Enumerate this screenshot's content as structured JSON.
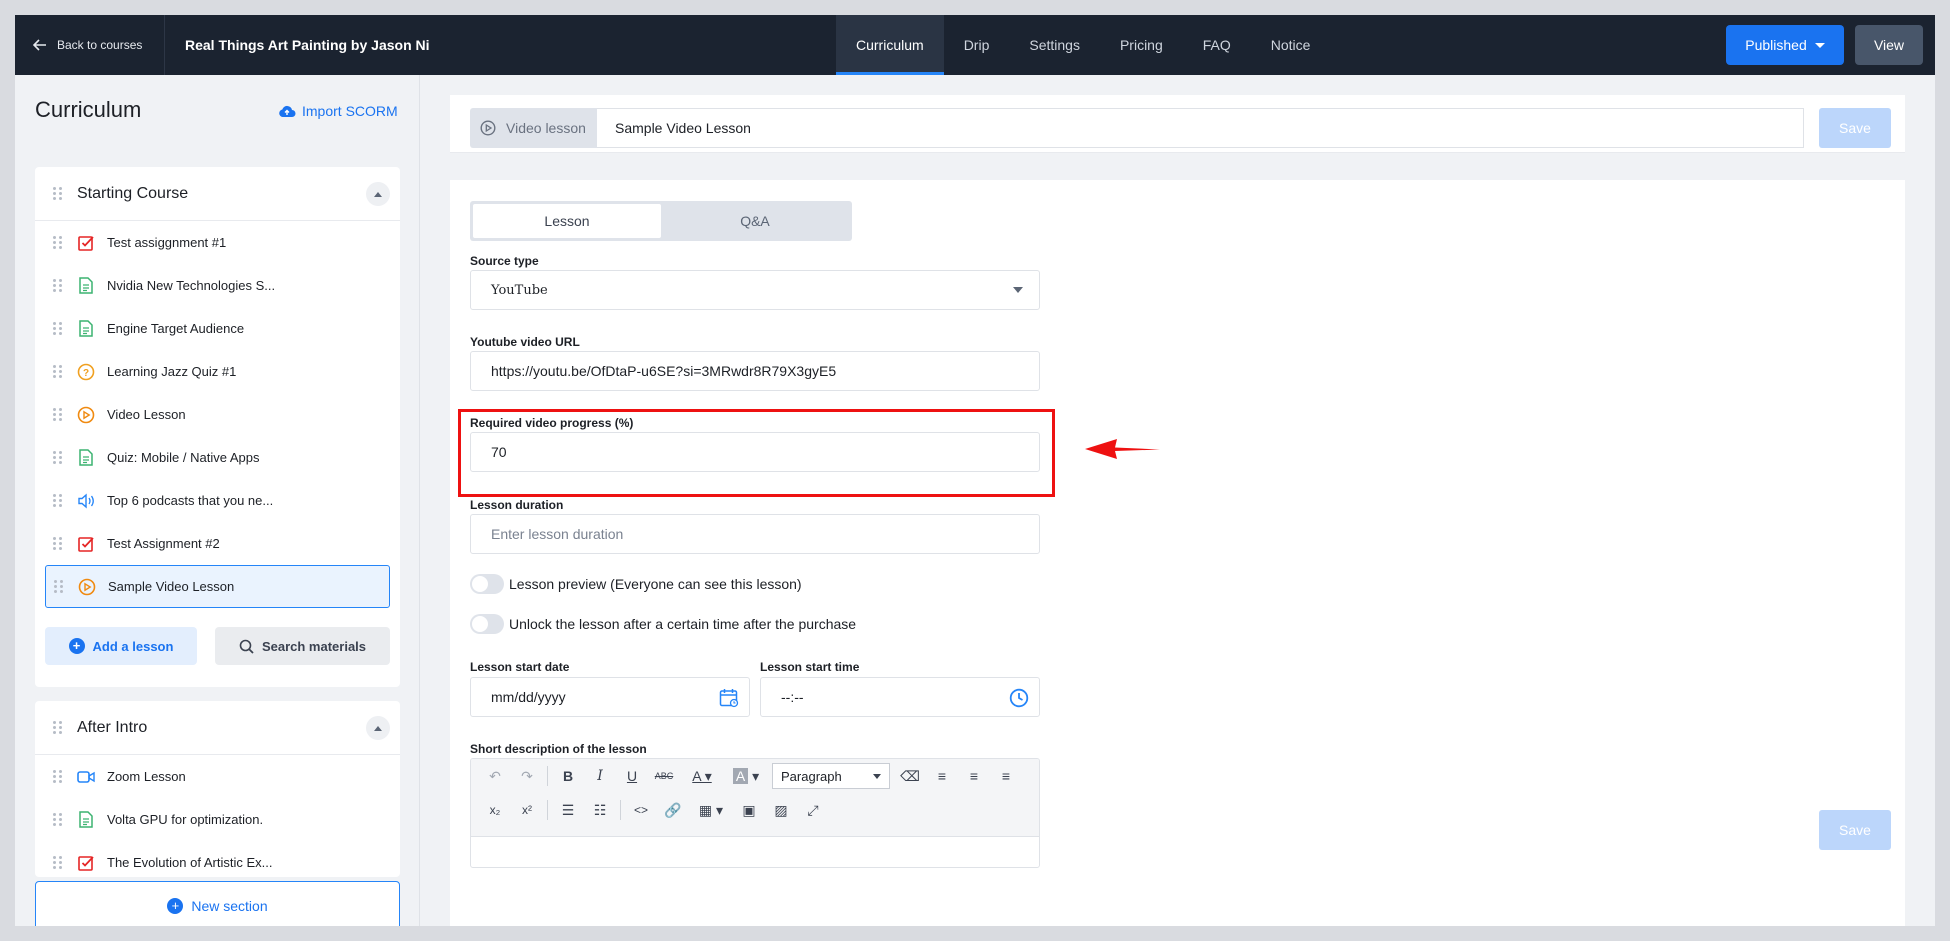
{
  "topbar": {
    "back_label": "Back to courses",
    "course_title": "Real Things Art Painting by Jason Ni",
    "tabs": [
      {
        "label": "Curriculum",
        "active": true
      },
      {
        "label": "Drip"
      },
      {
        "label": "Settings"
      },
      {
        "label": "Pricing"
      },
      {
        "label": "FAQ"
      },
      {
        "label": "Notice"
      }
    ],
    "published_label": "Published",
    "view_label": "View"
  },
  "sidebar": {
    "title": "Curriculum",
    "import_label": "Import SCORM",
    "sections": [
      {
        "title": "Starting Course",
        "lessons": [
          {
            "label": "Test assiggnment #1",
            "icon": "assignment-icon"
          },
          {
            "label": "Nvidia New Technologies S...",
            "icon": "text-lesson-icon"
          },
          {
            "label": "Engine Target Audience",
            "icon": "text-lesson-icon"
          },
          {
            "label": "Learning Jazz Quiz #1",
            "icon": "quiz-icon"
          },
          {
            "label": "Video Lesson",
            "icon": "video-lesson-icon"
          },
          {
            "label": "Quiz: Mobile / Native Apps",
            "icon": "text-lesson-icon"
          },
          {
            "label": "Top 6 podcasts that you ne...",
            "icon": "audio-lesson-icon"
          },
          {
            "label": "Test Assignment #2",
            "icon": "assignment-icon"
          },
          {
            "label": "Sample Video Lesson",
            "icon": "video-lesson-icon",
            "selected": true
          }
        ],
        "add_lesson_label": "Add a lesson",
        "search_materials_label": "Search materials"
      },
      {
        "title": "After Intro",
        "lessons": [
          {
            "label": "Zoom Lesson",
            "icon": "zoom-lesson-icon"
          },
          {
            "label": "Volta GPU for optimization.",
            "icon": "text-lesson-icon"
          },
          {
            "label": "The Evolution of Artistic Ex...",
            "icon": "assignment-icon"
          }
        ]
      }
    ],
    "new_section_label": "New section"
  },
  "editor": {
    "type_label": "Video lesson",
    "title_value": "Sample Video Lesson",
    "save_label": "Save",
    "segments": [
      "Lesson",
      "Q&A"
    ],
    "source_type": {
      "label": "Source type",
      "value": "YouTube"
    },
    "youtube_url": {
      "label": "Youtube video URL",
      "value": "https://youtu.be/OfDtaP-u6SE?si=3MRwdr8R79X3gyE5"
    },
    "required_progress": {
      "label": "Required video progress (%)",
      "value": "70"
    },
    "lesson_duration": {
      "label": "Lesson duration",
      "placeholder": "Enter lesson duration"
    },
    "preview_toggle_label": "Lesson preview (Everyone can see this lesson)",
    "unlock_toggle_label": "Unlock the lesson after a certain time after the purchase",
    "start_date": {
      "label": "Lesson start date",
      "value": "mm/dd/yyyy"
    },
    "start_time": {
      "label": "Lesson start time",
      "value": "--:--"
    },
    "short_description_label": "Short description of the lesson",
    "paragraph_select": "Paragraph"
  },
  "colors": {
    "topbar_bg": "#1b2330",
    "accent": "#1a73f0",
    "highlight": "#ee1111"
  }
}
